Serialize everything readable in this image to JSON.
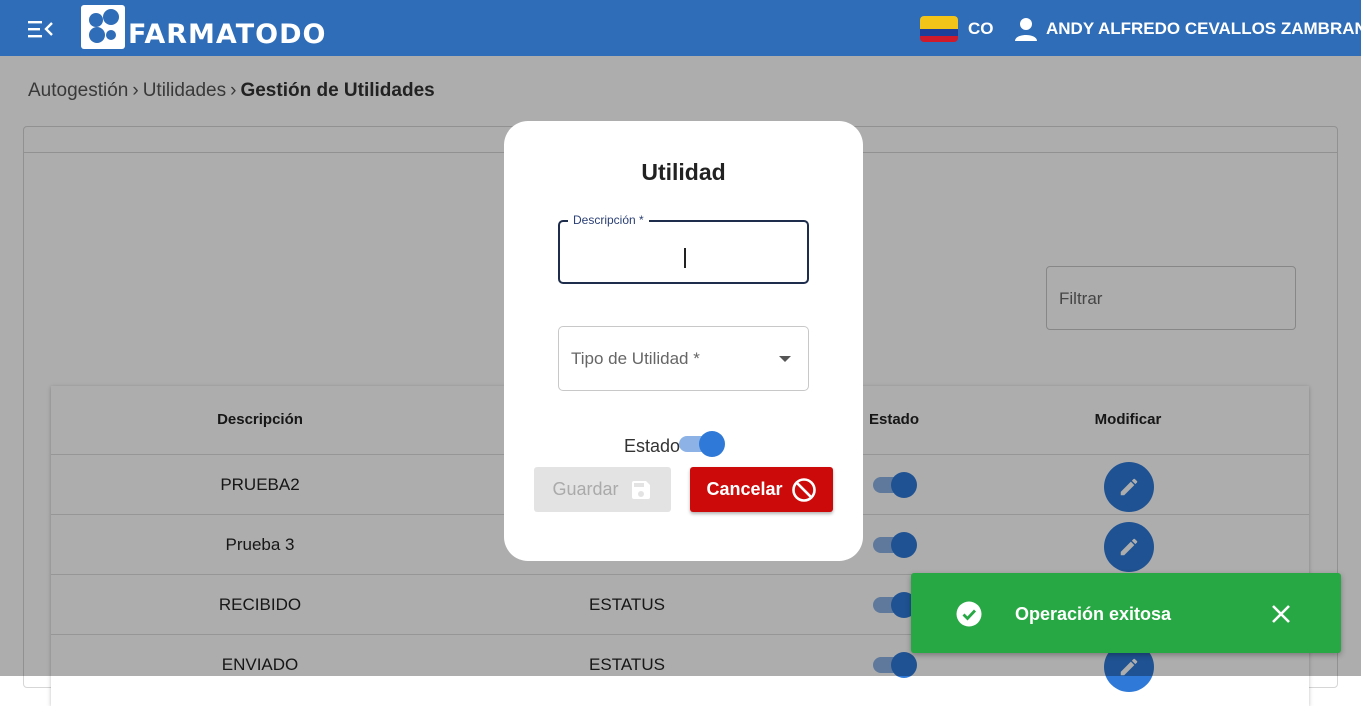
{
  "header": {
    "logo_text": "FARMATODO",
    "country_code": "CO",
    "user_name": "ANDY ALFREDO CEVALLOS ZAMBRANO",
    "bar_color": "#2f6db8"
  },
  "breadcrumb": {
    "item1": "Autogestión",
    "item2": "Utilidades",
    "current": "Gestión de Utilidades"
  },
  "filter": {
    "placeholder": "Filtrar"
  },
  "table": {
    "headers": {
      "descripcion": "Descripción",
      "estado": "Estado",
      "modificar": "Modificar"
    },
    "rows": [
      {
        "descripcion": "PRUEBA2",
        "tipo": "",
        "estado": true
      },
      {
        "descripcion": "Prueba 3",
        "tipo": "",
        "estado": true
      },
      {
        "descripcion": "RECIBIDO",
        "tipo": "ESTATUS",
        "estado": true
      },
      {
        "descripcion": "ENVIADO",
        "tipo": "ESTATUS",
        "estado": true
      }
    ]
  },
  "dialog": {
    "title": "Utilidad",
    "descripcion_label": "Descripción *",
    "descripcion_value": "",
    "tipo_label": "Tipo de Utilidad *",
    "estado_label": "Estado",
    "estado_on": true,
    "guardar_label": "Guardar",
    "cancelar_label": "Cancelar"
  },
  "snackbar": {
    "message": "Operación exitosa",
    "color": "#27a844"
  }
}
